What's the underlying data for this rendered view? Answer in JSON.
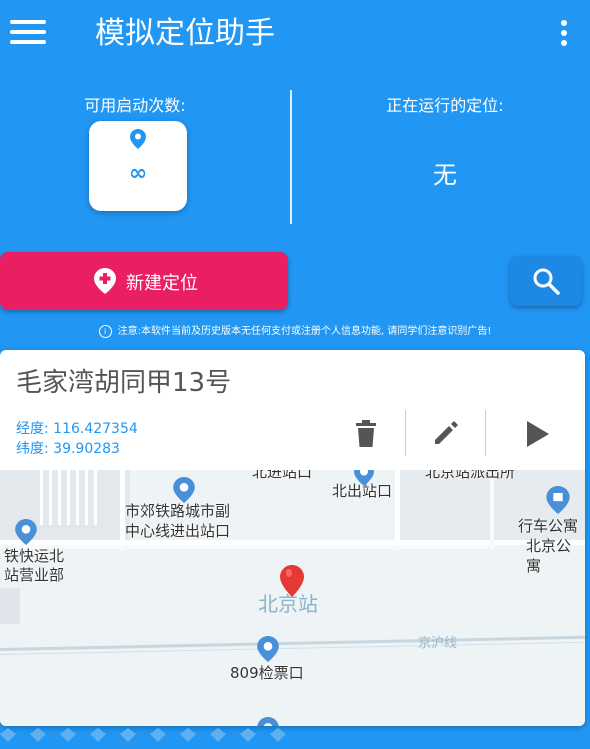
{
  "app": {
    "title": "模拟定位助手"
  },
  "stats": {
    "available_label": "可用启动次数:",
    "available_value": "∞",
    "running_label": "正在运行的定位:",
    "running_value": "无"
  },
  "actions": {
    "new_location_label": "新建定位"
  },
  "notice": {
    "text": "注意:本软件当前及历史版本无任何支付或注册个人信息功能, 请同学们注意识别广告!"
  },
  "location_card": {
    "name": "毛家湾胡同甲13号",
    "longitude_label": "经度: 116.427354",
    "latitude_label": "纬度: 39.90283"
  },
  "map": {
    "labels": {
      "top_cut_1": "北进站口",
      "top_cut_2": "北京站派出所",
      "north_exit": "北出站口",
      "suburban_1": "市郊铁路城市副",
      "suburban_2": "中心线进出站口",
      "rail_office_1": "铁快运北",
      "rail_office_2": "站营业部",
      "apartment_1": "行车公寓",
      "apartment_2": "北京公寓",
      "station": "北京站",
      "railway": "京沪线",
      "gate": "809检票口"
    }
  },
  "colors": {
    "primary": "#2196f3",
    "accent": "#e91e63",
    "marker": "#e53935",
    "poi": "#4a90d9"
  },
  "icons": {
    "menu": "hamburger-icon",
    "more": "more-vert-icon",
    "pin": "map-pin-icon",
    "add_location": "add-location-icon",
    "search": "search-icon",
    "info": "info-icon",
    "delete": "trash-icon",
    "edit": "pencil-icon",
    "start": "play-icon"
  }
}
